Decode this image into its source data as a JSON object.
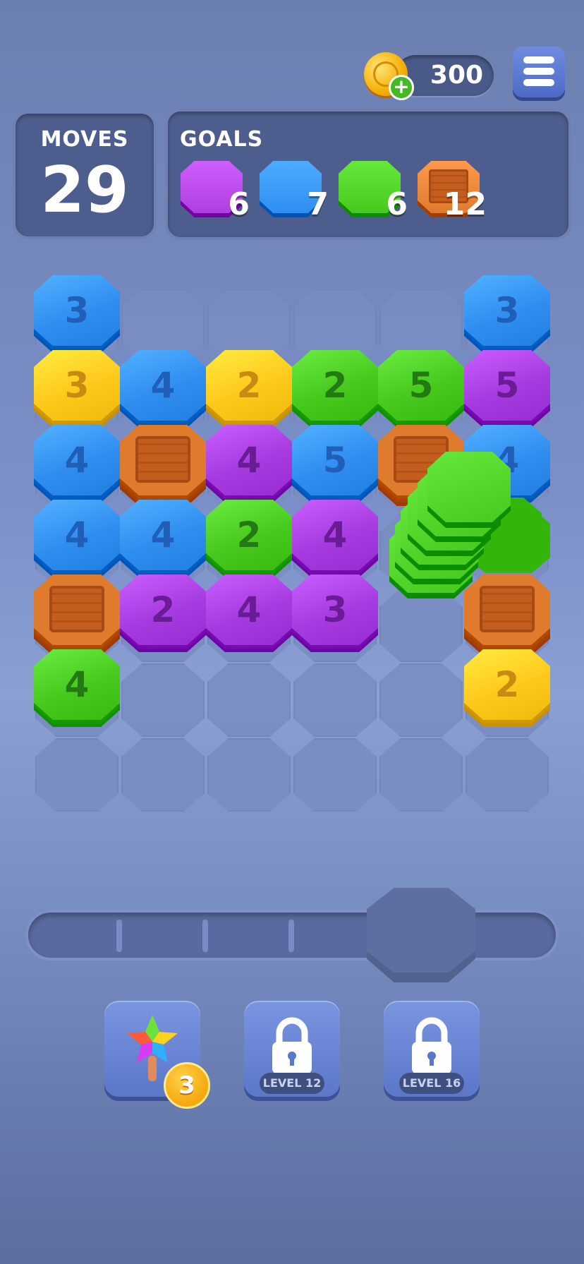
{
  "header": {
    "coins": "300",
    "coin_icon": "coin-icon",
    "add_coins_icon": "plus-icon",
    "menu_icon": "hamburger-menu-icon"
  },
  "moves": {
    "label": "MOVES",
    "value": "29"
  },
  "goals": {
    "label": "GOALS",
    "items": [
      {
        "type": "purple-tile",
        "color": "#b03fe0",
        "count": "6"
      },
      {
        "type": "blue-tile",
        "color": "#2f8ef0",
        "count": "7"
      },
      {
        "type": "green-tile",
        "color": "#47c91e",
        "count": "6"
      },
      {
        "type": "crate",
        "color": "#e07a2c",
        "count": "12"
      }
    ]
  },
  "colors": {
    "blue": "#2f8ef0",
    "yellow": "#ffc91c",
    "green": "#47c91e",
    "purple": "#a63be0",
    "crate": "#e07a2c"
  },
  "board": {
    "columns": 6,
    "rows": 7,
    "tiles": [
      {
        "row": 0,
        "col": 0,
        "color": "blue",
        "value": "3"
      },
      {
        "row": 0,
        "col": 5,
        "color": "blue",
        "value": "3"
      },
      {
        "row": 1,
        "col": 0,
        "color": "yellow",
        "value": "3"
      },
      {
        "row": 1,
        "col": 1,
        "color": "blue",
        "value": "4"
      },
      {
        "row": 1,
        "col": 2,
        "color": "yellow",
        "value": "2"
      },
      {
        "row": 1,
        "col": 3,
        "color": "green",
        "value": "2"
      },
      {
        "row": 1,
        "col": 4,
        "color": "green",
        "value": "5"
      },
      {
        "row": 1,
        "col": 5,
        "color": "purple",
        "value": "5"
      },
      {
        "row": 2,
        "col": 0,
        "color": "blue",
        "value": "4"
      },
      {
        "row": 2,
        "col": 1,
        "color": "crate",
        "value": ""
      },
      {
        "row": 2,
        "col": 2,
        "color": "purple",
        "value": "4"
      },
      {
        "row": 2,
        "col": 3,
        "color": "blue",
        "value": "5"
      },
      {
        "row": 2,
        "col": 4,
        "color": "crate",
        "value": ""
      },
      {
        "row": 2,
        "col": 5,
        "color": "blue",
        "value": "4"
      },
      {
        "row": 3,
        "col": 0,
        "color": "blue",
        "value": "4"
      },
      {
        "row": 3,
        "col": 1,
        "color": "blue",
        "value": "4"
      },
      {
        "row": 3,
        "col": 2,
        "color": "green",
        "value": "2"
      },
      {
        "row": 3,
        "col": 3,
        "color": "purple",
        "value": "4"
      },
      {
        "row": 4,
        "col": 0,
        "color": "crate",
        "value": ""
      },
      {
        "row": 4,
        "col": 1,
        "color": "purple",
        "value": "2"
      },
      {
        "row": 4,
        "col": 2,
        "color": "purple",
        "value": "4"
      },
      {
        "row": 4,
        "col": 3,
        "color": "purple",
        "value": "3"
      },
      {
        "row": 4,
        "col": 5,
        "color": "crate",
        "value": ""
      },
      {
        "row": 5,
        "col": 0,
        "color": "green",
        "value": "4"
      },
      {
        "row": 5,
        "col": 5,
        "color": "yellow",
        "value": "2"
      }
    ],
    "moving_stack": {
      "color": "green",
      "layers": 6
    }
  },
  "slider": {
    "ticks": 3,
    "handle": "octagon-handle"
  },
  "boosters": [
    {
      "name": "rainbow-star-wand",
      "icon": "rainbow-star-icon",
      "count": "3",
      "locked": false
    },
    {
      "name": "locked-booster-1",
      "icon": "lock-icon",
      "label": "LEVEL 12",
      "locked": true
    },
    {
      "name": "locked-booster-2",
      "icon": "lock-icon",
      "label": "LEVEL 16",
      "locked": true
    }
  ]
}
